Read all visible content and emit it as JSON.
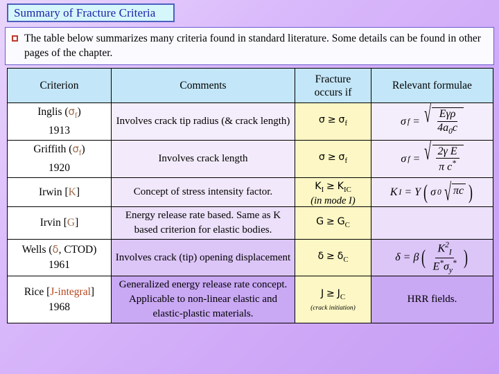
{
  "slide": {
    "title": "Summary of Fracture Criteria",
    "bullet_icon": "square-bullet-icon",
    "intro": "The table below summarizes many criteria found in standard literature. Some details can be found in other pages of the chapter."
  },
  "colors": {
    "background": "#d9b8fb",
    "title_box_fill": "#d5f6fb",
    "title_box_border": "#4d5fbf",
    "title_text": "#1b1fa8",
    "intro_box_fill": "#fbfaff",
    "intro_box_border": "#6a5bd0",
    "bullet": "#c0392b",
    "header_fill": "#c3e6f8",
    "fracture_column_fill": "#fcf7c4",
    "criterion_column_fill": "#ffffff",
    "accent_symbol": "#9c6a4a",
    "accent_red": "#b5461e"
  },
  "table": {
    "headers": [
      "Criterion",
      "Comments",
      "Fracture occurs if",
      "Relevant formulae"
    ],
    "header_fracture_line1": "Fracture",
    "header_fracture_line2": "occurs if",
    "rows": [
      {
        "criterion_name": "Inglis (",
        "criterion_symbol": "σ",
        "criterion_symbol_sub": "f",
        "criterion_close": ")",
        "criterion_year": "1913",
        "comments": "Involves crack tip radius (& crack length)",
        "fracture_if": "σ ≥ σf",
        "fracture_if_lhs": "σ",
        "fracture_if_rel": "≥",
        "fracture_if_rhs": "σ",
        "fracture_if_rhs_sub": "f",
        "formula_text": "σf = √(Eγρ / 4a0c)",
        "formula_lhs": "σ",
        "formula_lhs_sub": "f",
        "formula_num": "Eγρ",
        "formula_den_a": "4a",
        "formula_den_sub": "0",
        "formula_den_b": "c"
      },
      {
        "criterion_name": "Griffith (",
        "criterion_symbol": "σ",
        "criterion_symbol_sub": "f",
        "criterion_close": ")",
        "criterion_year": "1920",
        "comments": "Involves crack length",
        "fracture_if": "σ ≥ σf",
        "fracture_if_lhs": "σ",
        "fracture_if_rel": "≥",
        "fracture_if_rhs": "σ",
        "fracture_if_rhs_sub": "f",
        "formula_text": "σf = √(2γE / πc*)",
        "formula_lhs": "σ",
        "formula_lhs_sub": "f",
        "formula_num": "2γ E",
        "formula_den_a": "π c",
        "formula_den_sub": "*",
        "formula_den_b": ""
      },
      {
        "criterion_name": "Irwin [",
        "criterion_symbol": "K",
        "criterion_symbol_sub": "",
        "criterion_close": "]",
        "criterion_year": "",
        "comments": "Concept of stress intensity factor.",
        "fracture_if": "KI ≥ KIC",
        "fracture_if_lhs": "K",
        "fracture_if_lhs_sub": "I",
        "fracture_if_rel": "≥",
        "fracture_if_rhs": "K",
        "fracture_if_rhs_sub": "IC",
        "fracture_if_note": "(in mode I)",
        "formula_text": "KI = Y (σ0 √πc)",
        "formula_lhs": "K",
        "formula_lhs_sub": "I",
        "formula_y": "Y",
        "formula_sigma": "σ",
        "formula_sigma_sub": "0",
        "formula_rad": "πc"
      },
      {
        "criterion_name": "Irvin [",
        "criterion_symbol": "G",
        "criterion_symbol_sub": "",
        "criterion_close": "]",
        "criterion_year": "",
        "comments": "Energy release rate based. Same as K based criterion for elastic bodies.",
        "fracture_if": "G ≥ GC",
        "fracture_if_lhs": "G",
        "fracture_if_rel": "≥",
        "fracture_if_rhs": "G",
        "fracture_if_rhs_sub": "C",
        "formula_text": ""
      },
      {
        "criterion_name": "Wells (",
        "criterion_symbol": "δ",
        "criterion_symbol_sub": "",
        "criterion_extra": ", CTOD",
        "criterion_close": ")",
        "criterion_year": "1961",
        "comments": "Involves crack (tip) opening displacement",
        "fracture_if": "δ ≥ δC",
        "fracture_if_lhs": "δ",
        "fracture_if_rel": "≥",
        "fracture_if_rhs": "δ",
        "fracture_if_rhs_sub": "C",
        "formula_text": "δ = β (KI² / E* σy*)",
        "formula_lhs": "δ",
        "formula_beta": "β",
        "formula_num": "K",
        "formula_num_sub": "I",
        "formula_num_sup": "2",
        "formula_den_a": "E",
        "formula_den_sup": "*",
        "formula_den_b": "σ",
        "formula_den_b_sub": "y",
        "formula_den_b_sup": "*"
      },
      {
        "criterion_name": "Rice [",
        "criterion_symbol": "J-integral",
        "criterion_symbol_sub": "",
        "criterion_close": "]",
        "criterion_year": "1968",
        "comments": "Generalized energy release rate concept. Applicable to non-linear elastic and elastic-plastic materials.",
        "fracture_if": "J ≥ JC",
        "fracture_if_lhs": "J",
        "fracture_if_rel": "≥",
        "fracture_if_rhs": "J",
        "fracture_if_rhs_sub": "C",
        "fracture_if_note": "(crack initiation)",
        "formula_text": "HRR fields."
      }
    ]
  }
}
